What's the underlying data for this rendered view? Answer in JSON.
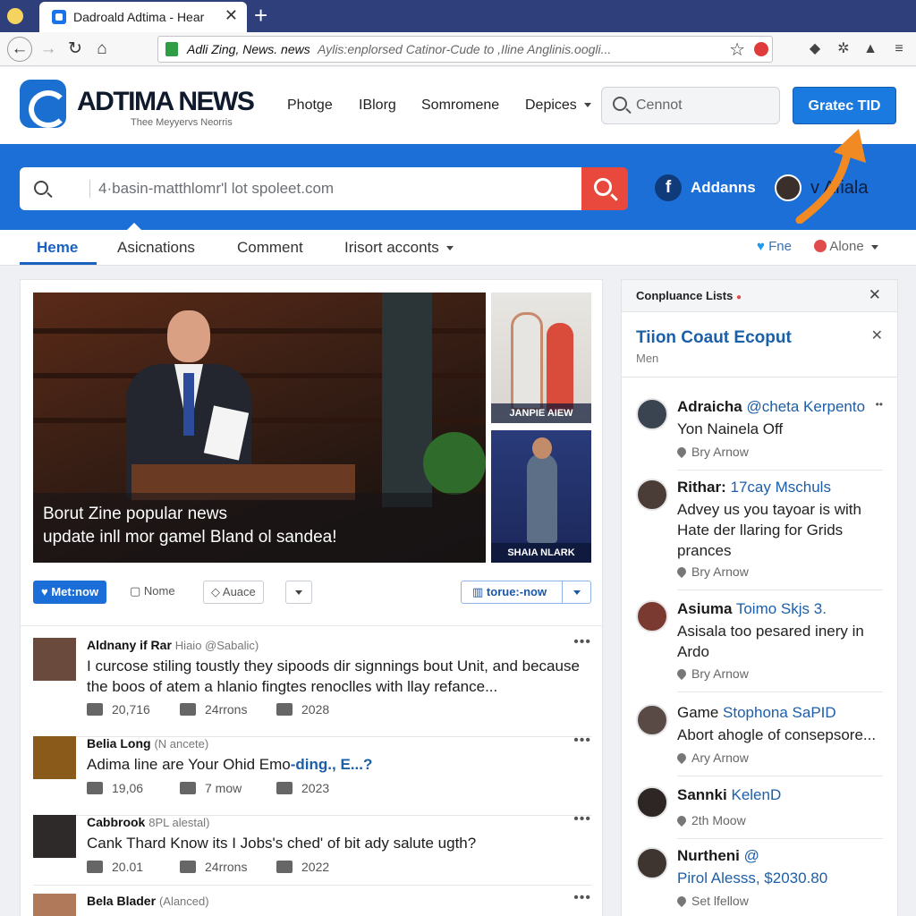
{
  "browser": {
    "tab_title": "Dadroald Adtima - Hear",
    "tab_close": "✕",
    "new_tab": "+",
    "url_main": "Adli Zing, News. news",
    "url_rest": "Aylis:enplorsed Catinor-Cude to ,Iline Anglinis.oogli...",
    "icons": [
      "back-arrow-icon",
      "forward-arrow-icon",
      "reload-icon",
      "home-icon",
      "lock-icon",
      "star-icon",
      "extension-icon",
      "shield-icon",
      "settings-icon",
      "bag-icon",
      "menu-icon"
    ]
  },
  "site": {
    "brand": "ADTIMA NEWS",
    "tagline": "Thee Meyyervs Neorris",
    "nav": [
      "Photge",
      "IBlorg",
      "Somromene",
      "Depices"
    ],
    "search_placeholder": "Cennot",
    "cta_label": "Gratec TID"
  },
  "band": {
    "search_placeholder": "4·basin-matthlomr'l lot spoleet.com",
    "user_name": "Addanns",
    "extra_text": "v Afiala",
    "fb_letter": "f"
  },
  "section_tabs": {
    "items": [
      "Heme",
      "Asicnations",
      "Comment",
      "Irisort acconts"
    ],
    "right_links": [
      "Fne",
      "Alone"
    ],
    "active_index": 0
  },
  "main": {
    "hero_caption_line1": "Borut Zine popular news",
    "hero_caption_line2": "update inll mor gamel Bland ol sandea!",
    "thumb1_label": "JANPIE AIEW",
    "thumb2_label": "SHAIA NLARK",
    "actions": {
      "primary": "Met:now",
      "none": "Nome",
      "auace": "Auace",
      "follow": "torue:-now"
    },
    "posts": [
      {
        "name": "Aldnany if Rar",
        "handle": "Hiaio @Sabalic)",
        "body": "I curcose stiling toustly they sipoods dir signnings bout Unit, and because the boos of atem a hlanio fingtes renoclles with llay refance...",
        "likes": "20,716",
        "shares": "24rrons",
        "year": "2028",
        "accent": "#6a4a3c"
      },
      {
        "name": "Belia Long",
        "handle": "(N ancete)",
        "body": "Adima line are Your Ohid Emo",
        "body_link": "-ding., E...?",
        "likes": "19,06",
        "shares": "7 mow",
        "year": "2023",
        "accent": "#8a5a1a"
      },
      {
        "name": "Cabbrook",
        "handle": "8PL alestal)",
        "body": "Cank Thard Know its I Jobs's ched' of bit ady salute ugth?",
        "likes": "20.01",
        "shares": "24rrons",
        "year": "2022",
        "accent": "#2e2a2a"
      },
      {
        "name": "Bela Blader",
        "handle": "(Alanced)",
        "body": "",
        "likes": "",
        "shares": "",
        "year": "",
        "accent": "#b07a5a"
      }
    ]
  },
  "sidepanel": {
    "header": "Conpluance Lists",
    "sub_title": "Tiion Coaut Ecoput",
    "sub_meta": "Men",
    "contacts": [
      {
        "name": "Adraicha",
        "accent": "@cheta Kerpento",
        "body": "Yon Nainela Off",
        "foot": "Bry Arnow"
      },
      {
        "name": "Rithar:",
        "accent": "17cay Mschuls",
        "body": "Advey us you tayoar is with Hate der llaring for Grids prances",
        "foot": "Bry Arnow"
      },
      {
        "name": "Asiuma",
        "accent": "Toimo Skjs 3.",
        "body": "Asisala too pesared inery in Ardo",
        "foot": "Bry Arnow"
      },
      {
        "name": "Game",
        "accent": "Stophona SaPID",
        "body": "Abort ahogle of consepsore...",
        "foot": "Ary Arnow"
      },
      {
        "name": "Sannki",
        "accent": "KelenD",
        "body": "",
        "foot": "2th Moow"
      },
      {
        "name": "Nurtheni",
        "accent": "@",
        "body": "Pirol Alesss, $2030.80",
        "foot": "Set lfellow"
      }
    ]
  },
  "colors": {
    "brand_blue": "#1c6fd6",
    "cta_blue": "#1b7ae0",
    "search_red": "#e8493c",
    "arrow_orange": "#f28a24",
    "tab_bar": "#2f3f7c"
  }
}
